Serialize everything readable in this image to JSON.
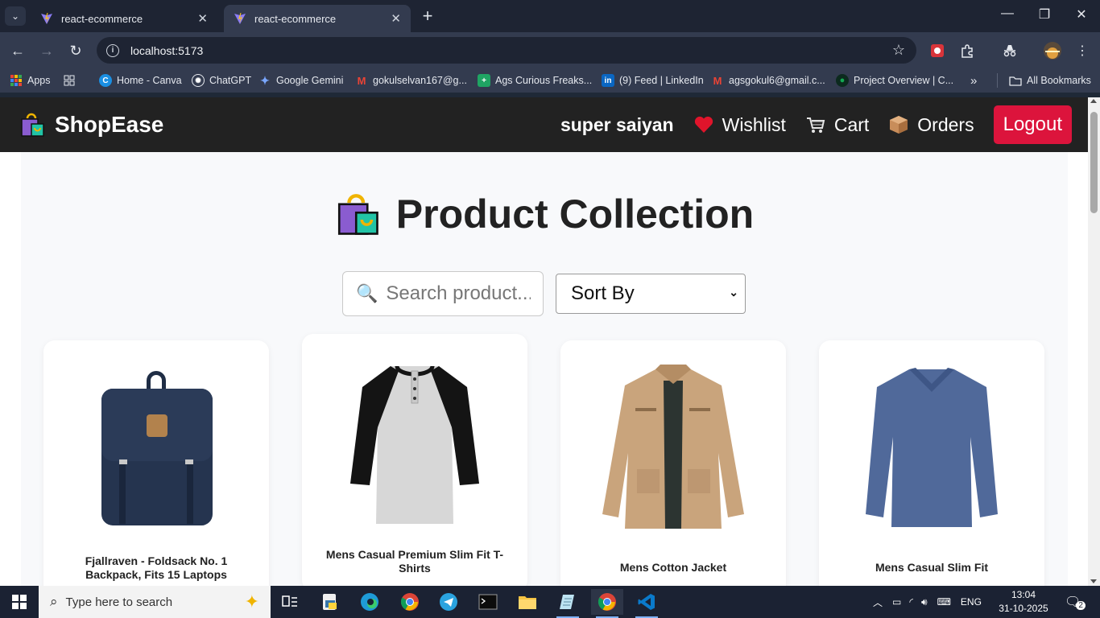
{
  "browser": {
    "tabs": [
      {
        "title": "react-ecommerce",
        "active": false
      },
      {
        "title": "react-ecommerce",
        "active": true
      }
    ],
    "url": "localhost:5173",
    "bookmarks": [
      {
        "label": "Apps",
        "icon": "apps-grid-icon"
      },
      {
        "label": "",
        "icon": "tab-groups-icon"
      },
      {
        "label": "Home - Canva",
        "icon": "canva-icon"
      },
      {
        "label": "ChatGPT",
        "icon": "chatgpt-icon"
      },
      {
        "label": "Google Gemini",
        "icon": "gemini-icon"
      },
      {
        "label": "gokulselvan167@g...",
        "icon": "gmail-icon"
      },
      {
        "label": "Ags Curious Freaks...",
        "icon": "sheets-icon"
      },
      {
        "label": "(9) Feed | LinkedIn",
        "icon": "linkedin-icon"
      },
      {
        "label": "agsgokul6@gmail.c...",
        "icon": "gmail-icon"
      },
      {
        "label": "Project Overview | C...",
        "icon": "mongodb-icon"
      }
    ],
    "more_bookmarks": "»",
    "all_bookmarks": "All Bookmarks"
  },
  "navbar": {
    "brand": "ShopEase",
    "user": "super saiyan",
    "links": [
      {
        "label": "Wishlist",
        "icon": "heart-icon"
      },
      {
        "label": "Cart",
        "icon": "cart-icon"
      },
      {
        "label": "Orders",
        "icon": "package-icon"
      }
    ],
    "logout": "Logout"
  },
  "page": {
    "title": "Product Collection",
    "search_placeholder": "Search product...",
    "sort_label": "Sort By"
  },
  "products": [
    {
      "title": "Fjallraven - Foldsack No. 1 Backpack, Fits 15 Laptops",
      "image": "backpack"
    },
    {
      "title": "Mens Casual Premium Slim Fit T-Shirts",
      "image": "raglan-tshirt"
    },
    {
      "title": "Mens Cotton Jacket",
      "image": "jacket"
    },
    {
      "title": "Mens Casual Slim Fit",
      "image": "long-sleeve-shirt"
    }
  ],
  "taskbar": {
    "search_placeholder": "Type here to search",
    "language": "ENG",
    "time": "13:04",
    "date": "31-10-2025",
    "notifications": "2"
  },
  "colors": {
    "navbar_bg": "#222222",
    "logout_bg": "#dc143c",
    "content_bg": "#f8f9fb",
    "browser_chrome": "#333b4f"
  }
}
